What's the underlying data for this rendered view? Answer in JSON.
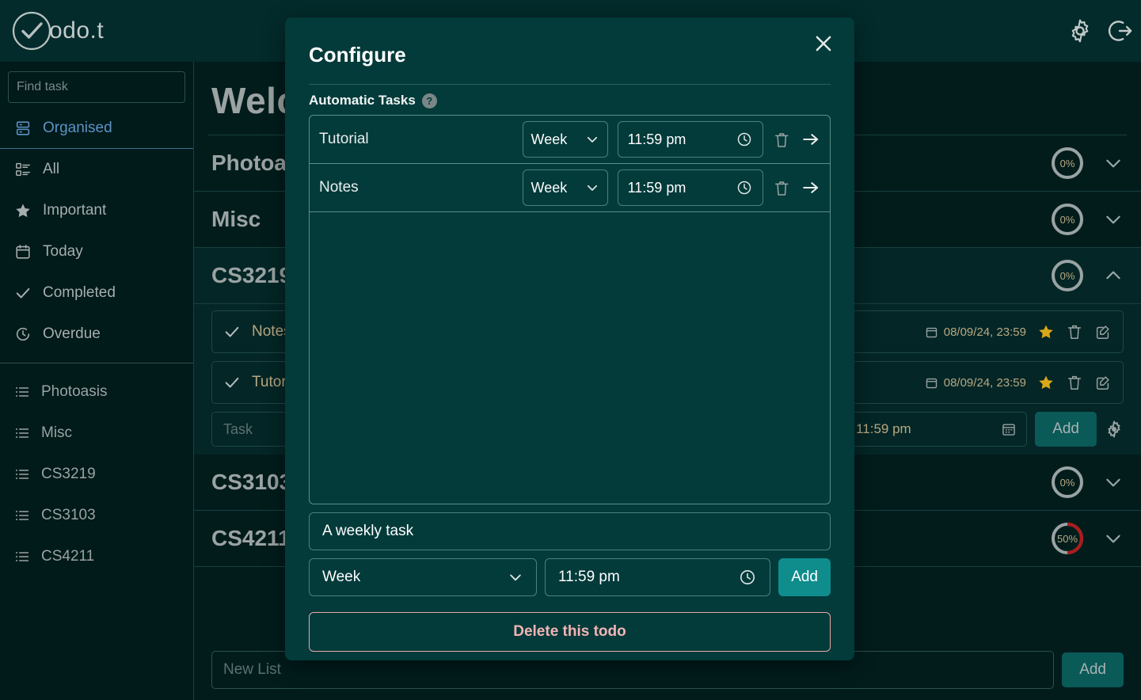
{
  "header": {
    "brand": "odo.t",
    "logo_icon": "check-circle-icon",
    "settings_icon": "gear-icon",
    "logout_icon": "logout-icon"
  },
  "sidebar": {
    "search": {
      "placeholder": "Find task",
      "value": "",
      "icon": "search-icon"
    },
    "nav": [
      {
        "label": "Organised",
        "icon": "organised-icon",
        "active": true
      },
      {
        "label": "All",
        "icon": "list-detail-icon",
        "active": false
      },
      {
        "label": "Important",
        "icon": "star-icon",
        "active": false
      },
      {
        "label": "Today",
        "icon": "calendar-icon",
        "active": false
      },
      {
        "label": "Completed",
        "icon": "check-icon",
        "active": false
      },
      {
        "label": "Overdue",
        "icon": "clock-history-icon",
        "active": false
      }
    ],
    "lists": [
      {
        "label": "Photoasis",
        "icon": "list-icon"
      },
      {
        "label": "Misc",
        "icon": "list-icon"
      },
      {
        "label": "CS3219",
        "icon": "list-icon"
      },
      {
        "label": "CS3103",
        "icon": "list-icon"
      },
      {
        "label": "CS4211",
        "icon": "list-icon"
      }
    ]
  },
  "main": {
    "welcome_title": "Welcome",
    "groups": [
      {
        "name": "Photoasis",
        "progress": "0%",
        "percent": 0,
        "expanded": false,
        "chevron": "chevron-down-icon"
      },
      {
        "name": "Misc",
        "progress": "0%",
        "percent": 0,
        "expanded": false,
        "chevron": "chevron-down-icon"
      },
      {
        "name": "CS3219",
        "progress": "0%",
        "percent": 0,
        "expanded": true,
        "chevron": "chevron-up-icon"
      },
      {
        "name": "CS3103",
        "progress": "0%",
        "percent": 0,
        "expanded": false,
        "chevron": "chevron-down-icon"
      },
      {
        "name": "CS4211",
        "progress": "50%",
        "percent": 50,
        "expanded": false,
        "chevron": "chevron-down-icon"
      }
    ],
    "tasks": [
      {
        "name": "Notes",
        "date": "08/09/24, 23:59",
        "check_icon": "check-icon",
        "calendar_icon": "calendar-icon",
        "star_icon": "star-icon",
        "delete_icon": "trash-icon",
        "edit_icon": "edit-icon"
      },
      {
        "name": "Tutorial",
        "date": "08/09/24, 23:59",
        "check_icon": "check-icon",
        "calendar_icon": "calendar-icon",
        "star_icon": "star-icon",
        "delete_icon": "trash-icon",
        "edit_icon": "edit-icon"
      }
    ],
    "add_task": {
      "placeholder": "Task",
      "value": "",
      "date_value": "08/09/24 11:59 pm",
      "date_icon": "calendar-picker-icon",
      "add_label": "Add",
      "settings_icon": "gear-icon"
    },
    "new_list": {
      "placeholder": "New List",
      "value": "",
      "add_label": "Add"
    }
  },
  "modal": {
    "title": "Configure",
    "close_icon": "close-icon",
    "section_label": "Automatic Tasks",
    "help_icon": "help-icon",
    "help_glyph": "?",
    "auto_tasks": [
      {
        "name": "Tutorial",
        "frequency": "Week",
        "time": "11:59 pm",
        "chevron_icon": "chevron-down-icon",
        "clock_icon": "clock-icon",
        "delete_icon": "trash-icon",
        "go_icon": "arrow-right-icon"
      },
      {
        "name": "Notes",
        "frequency": "Week",
        "time": "11:59 pm",
        "chevron_icon": "chevron-down-icon",
        "clock_icon": "clock-icon",
        "delete_icon": "trash-icon",
        "go_icon": "arrow-right-icon"
      }
    ],
    "new_task": {
      "value": "A weekly task",
      "placeholder": "",
      "frequency": "Week",
      "time": "11:59 pm",
      "chevron_icon": "chevron-down-icon",
      "clock_icon": "clock-icon",
      "add_label": "Add"
    },
    "delete_label": "Delete this todo"
  },
  "colors": {
    "accent_teal": "#0f8c8c",
    "page_bg": "#011a1a",
    "modal_bg": "#033a3a",
    "danger": "#f4b4b4",
    "progress_red": "#b01a1a",
    "star_gold": "#d8a81a",
    "active_blue": "#5d93c4"
  }
}
